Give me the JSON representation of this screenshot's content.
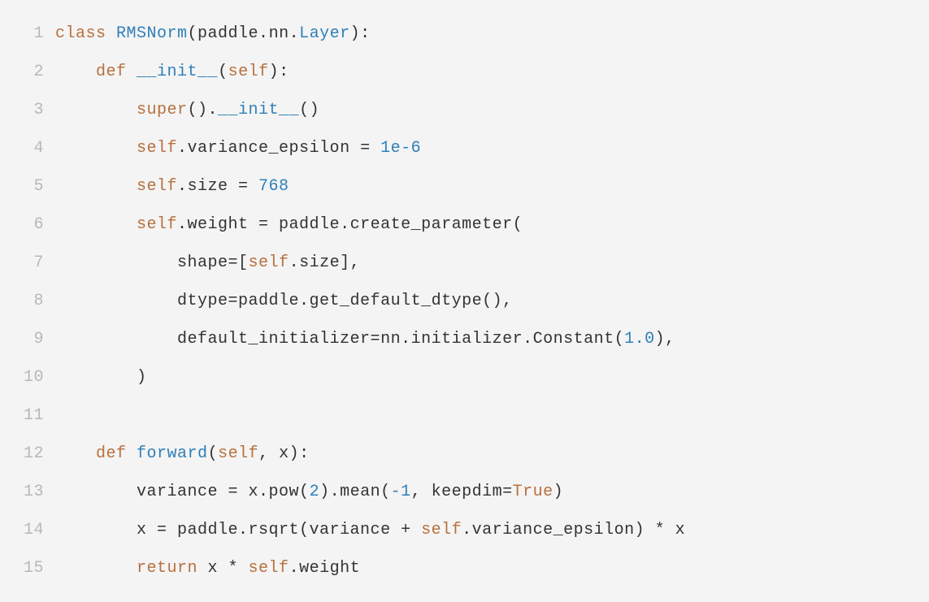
{
  "code": {
    "language": "python",
    "lines": [
      {
        "num": "1",
        "tokens": [
          {
            "cls": "tok-keyword",
            "t": "class"
          },
          {
            "cls": "tok-plain",
            "t": " "
          },
          {
            "cls": "tok-classname",
            "t": "RMSNorm"
          },
          {
            "cls": "tok-plain",
            "t": "(paddle.nn."
          },
          {
            "cls": "tok-classname",
            "t": "Layer"
          },
          {
            "cls": "tok-plain",
            "t": "):"
          }
        ]
      },
      {
        "num": "2",
        "tokens": [
          {
            "cls": "tok-plain",
            "t": "    "
          },
          {
            "cls": "tok-keyword",
            "t": "def"
          },
          {
            "cls": "tok-plain",
            "t": " "
          },
          {
            "cls": "tok-funcname",
            "t": "__init__"
          },
          {
            "cls": "tok-plain",
            "t": "("
          },
          {
            "cls": "tok-builtin",
            "t": "self"
          },
          {
            "cls": "tok-plain",
            "t": "):"
          }
        ]
      },
      {
        "num": "3",
        "tokens": [
          {
            "cls": "tok-plain",
            "t": "        "
          },
          {
            "cls": "tok-builtin",
            "t": "super"
          },
          {
            "cls": "tok-plain",
            "t": "()."
          },
          {
            "cls": "tok-funcname",
            "t": "__init__"
          },
          {
            "cls": "tok-plain",
            "t": "()"
          }
        ]
      },
      {
        "num": "4",
        "tokens": [
          {
            "cls": "tok-plain",
            "t": "        "
          },
          {
            "cls": "tok-builtin",
            "t": "self"
          },
          {
            "cls": "tok-plain",
            "t": ".variance_epsilon = "
          },
          {
            "cls": "tok-number",
            "t": "1e-6"
          }
        ]
      },
      {
        "num": "5",
        "tokens": [
          {
            "cls": "tok-plain",
            "t": "        "
          },
          {
            "cls": "tok-builtin",
            "t": "self"
          },
          {
            "cls": "tok-plain",
            "t": ".size = "
          },
          {
            "cls": "tok-number",
            "t": "768"
          }
        ]
      },
      {
        "num": "6",
        "tokens": [
          {
            "cls": "tok-plain",
            "t": "        "
          },
          {
            "cls": "tok-builtin",
            "t": "self"
          },
          {
            "cls": "tok-plain",
            "t": ".weight = paddle.create_parameter("
          }
        ]
      },
      {
        "num": "7",
        "tokens": [
          {
            "cls": "tok-plain",
            "t": "            shape=["
          },
          {
            "cls": "tok-builtin",
            "t": "self"
          },
          {
            "cls": "tok-plain",
            "t": ".size],"
          }
        ]
      },
      {
        "num": "8",
        "tokens": [
          {
            "cls": "tok-plain",
            "t": "            dtype=paddle.get_default_dtype(),"
          }
        ]
      },
      {
        "num": "9",
        "tokens": [
          {
            "cls": "tok-plain",
            "t": "            default_initializer=nn.initializer.Constant("
          },
          {
            "cls": "tok-number",
            "t": "1.0"
          },
          {
            "cls": "tok-plain",
            "t": "),"
          }
        ]
      },
      {
        "num": "10",
        "tokens": [
          {
            "cls": "tok-plain",
            "t": "        )"
          }
        ]
      },
      {
        "num": "11",
        "tokens": [
          {
            "cls": "tok-plain",
            "t": ""
          }
        ]
      },
      {
        "num": "12",
        "tokens": [
          {
            "cls": "tok-plain",
            "t": "    "
          },
          {
            "cls": "tok-keyword",
            "t": "def"
          },
          {
            "cls": "tok-plain",
            "t": " "
          },
          {
            "cls": "tok-funcname",
            "t": "forward"
          },
          {
            "cls": "tok-plain",
            "t": "("
          },
          {
            "cls": "tok-builtin",
            "t": "self"
          },
          {
            "cls": "tok-plain",
            "t": ", x):"
          }
        ]
      },
      {
        "num": "13",
        "tokens": [
          {
            "cls": "tok-plain",
            "t": "        variance = x.pow("
          },
          {
            "cls": "tok-number",
            "t": "2"
          },
          {
            "cls": "tok-plain",
            "t": ").mean("
          },
          {
            "cls": "tok-number",
            "t": "-1"
          },
          {
            "cls": "tok-plain",
            "t": ", keepdim="
          },
          {
            "cls": "tok-boolean",
            "t": "True"
          },
          {
            "cls": "tok-plain",
            "t": ")"
          }
        ]
      },
      {
        "num": "14",
        "tokens": [
          {
            "cls": "tok-plain",
            "t": "        x = paddle.rsqrt(variance + "
          },
          {
            "cls": "tok-builtin",
            "t": "self"
          },
          {
            "cls": "tok-plain",
            "t": ".variance_epsilon) * x"
          }
        ]
      },
      {
        "num": "15",
        "tokens": [
          {
            "cls": "tok-plain",
            "t": "        "
          },
          {
            "cls": "tok-keyword",
            "t": "return"
          },
          {
            "cls": "tok-plain",
            "t": " x * "
          },
          {
            "cls": "tok-builtin",
            "t": "self"
          },
          {
            "cls": "tok-plain",
            "t": ".weight"
          }
        ]
      }
    ]
  }
}
